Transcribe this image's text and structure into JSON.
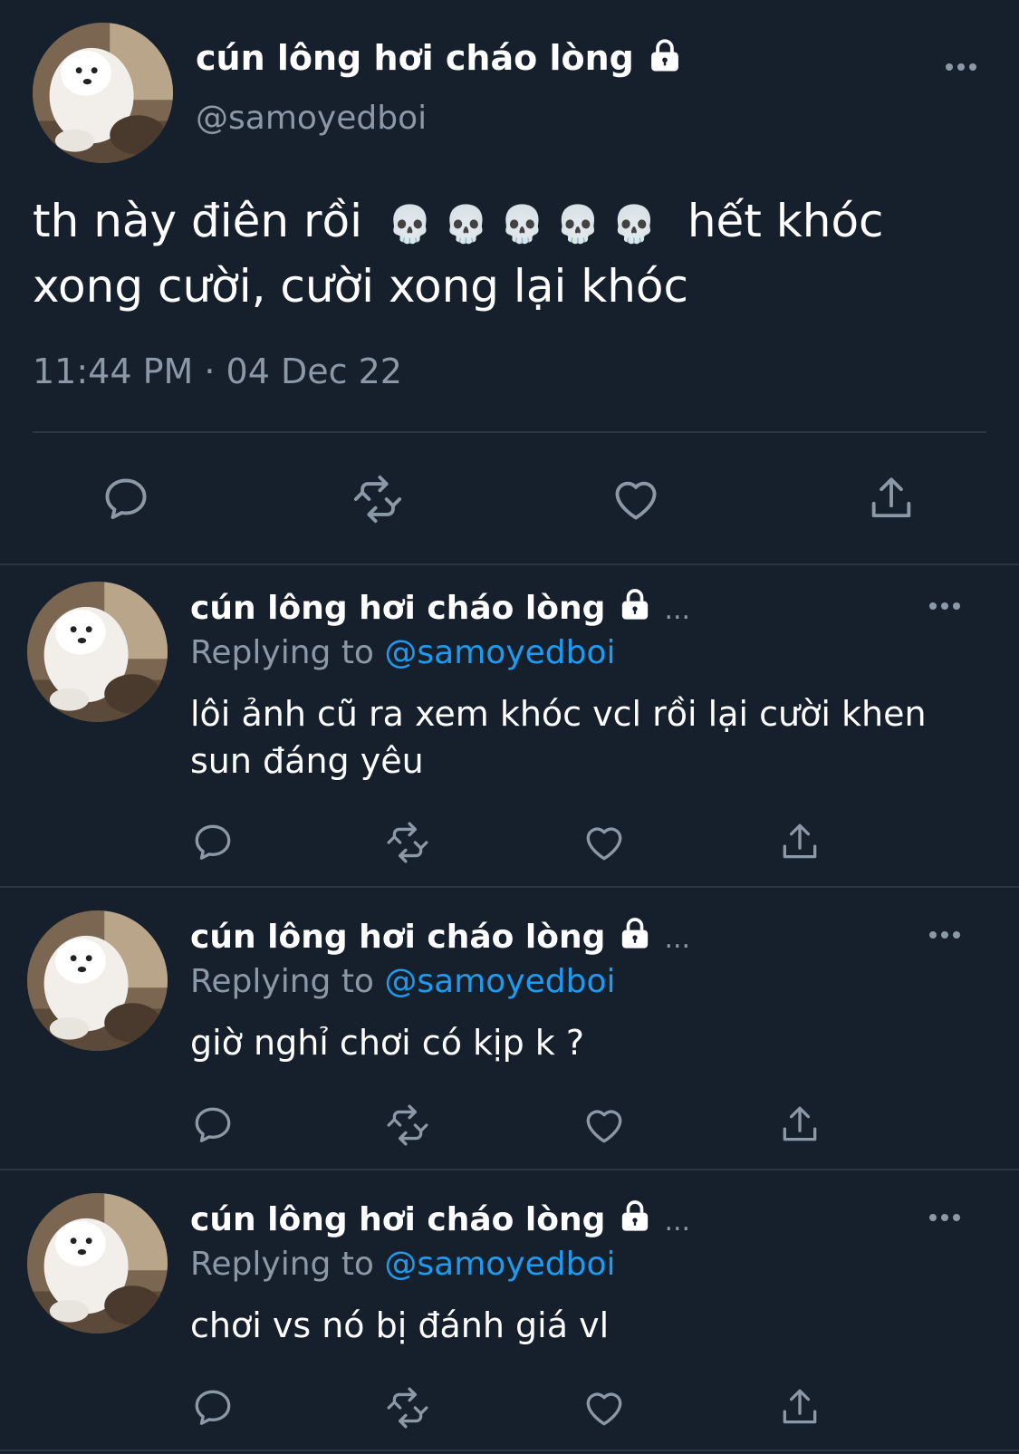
{
  "main_tweet": {
    "display_name": "cún lông hơi cháo lòng",
    "handle": "@samoyedboi",
    "text_line1_before": "th này điên rồi",
    "emoji": "💀💀💀💀💀",
    "text_line1_after": "hết khóc",
    "text_line2": "xong cười, cười xong lại khóc",
    "timestamp": "11:44 PM · 04 Dec 22"
  },
  "replies": [
    {
      "display_name": "cún lông hơi cháo lòng",
      "ellipsis": "...",
      "replying_label": "Replying to",
      "replying_handle": "@samoyedboi",
      "text_lines": [
        "lôi ảnh cũ ra xem khóc vcl rồi lại cười khen",
        "sun đáng yêu"
      ]
    },
    {
      "display_name": "cún lông hơi cháo lòng",
      "ellipsis": "...",
      "replying_label": "Replying to",
      "replying_handle": "@samoyedboi",
      "text_lines": [
        "giờ nghỉ chơi có kịp k ?"
      ]
    },
    {
      "display_name": "cún lông hơi cháo lòng",
      "ellipsis": "...",
      "replying_label": "Replying to",
      "replying_handle": "@samoyedboi",
      "text_lines": [
        "chơi vs nó bị đánh giá vl"
      ]
    }
  ],
  "icons": {
    "more": "more-horizontal-icon",
    "lock": "lock-icon",
    "reply": "reply-icon",
    "retweet": "retweet-icon",
    "like": "heart-icon",
    "share": "share-icon"
  },
  "colors": {
    "background": "#16202c",
    "text": "#ffffff",
    "secondary": "#8b98a5",
    "link": "#1d9bf0",
    "divider": "#2a3643"
  }
}
